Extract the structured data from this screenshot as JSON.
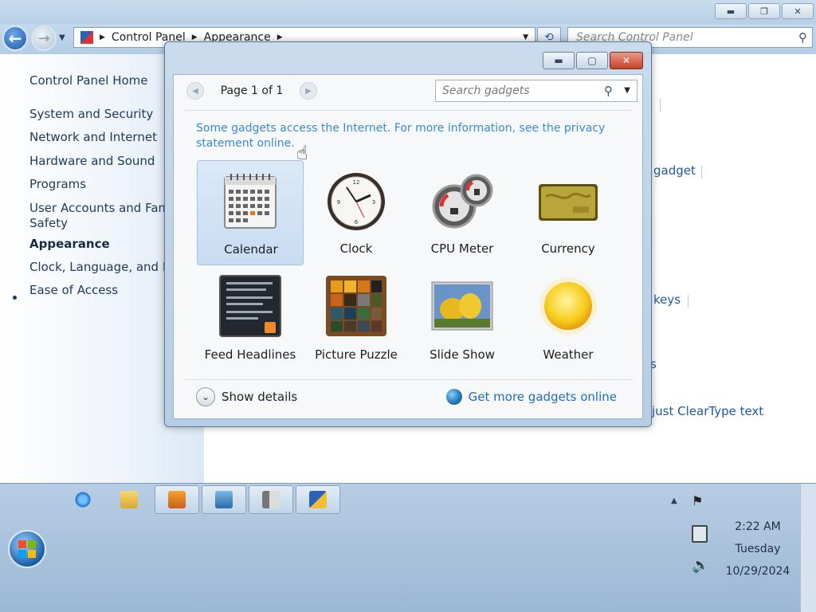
{
  "control_panel": {
    "address": {
      "segments": [
        "Control Panel",
        "Appearance"
      ],
      "search_placeholder": "Search Control Panel"
    },
    "sidebar": {
      "home": "Control Panel Home",
      "items": [
        {
          "label": "System and Security"
        },
        {
          "label": "Network and Internet"
        },
        {
          "label": "Hardware and Sound"
        },
        {
          "label": "Programs"
        },
        {
          "label": "User Accounts and Family"
        },
        {
          "label": "Safety"
        },
        {
          "label": "Appearance"
        },
        {
          "label": "Clock, Language, and Re"
        },
        {
          "label": "Ease of Access"
        }
      ]
    },
    "right_links": [
      "gadget",
      "keys",
      "s",
      "just ClearType text"
    ]
  },
  "gadget_window": {
    "page_label": "Page 1 of 1",
    "search_placeholder": "Search gadgets",
    "privacy_note": "Some gadgets access the Internet.  For more information, see the privacy statement online.",
    "gadgets": [
      {
        "name": "Calendar",
        "icon": "calendar-icon"
      },
      {
        "name": "Clock",
        "icon": "clock-icon"
      },
      {
        "name": "CPU Meter",
        "icon": "cpu-meter-icon"
      },
      {
        "name": "Currency",
        "icon": "currency-icon"
      },
      {
        "name": "Feed Headlines",
        "icon": "feed-headlines-icon"
      },
      {
        "name": "Picture Puzzle",
        "icon": "picture-puzzle-icon"
      },
      {
        "name": "Slide Show",
        "icon": "slide-show-icon"
      },
      {
        "name": "Weather",
        "icon": "weather-icon"
      }
    ],
    "show_details": "Show details",
    "more_gadgets": "Get more gadgets online"
  },
  "taskbar": {
    "clock": {
      "time": "2:22 AM",
      "day": "Tuesday",
      "date": "10/29/2024"
    }
  },
  "colors": {
    "link": "#1f5aa8",
    "privacy_link": "#3a8ad6",
    "selected_tile": "#c8dcf2"
  }
}
